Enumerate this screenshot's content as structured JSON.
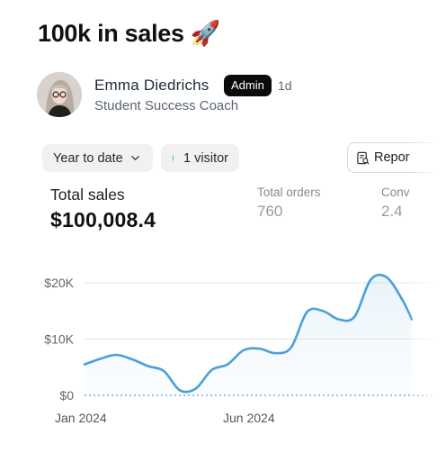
{
  "post": {
    "title": "100k in sales 🚀"
  },
  "author": {
    "name": "Emma Diedrichs",
    "badge": "Admin",
    "age": "1d",
    "role": "Student Success Coach"
  },
  "filters": {
    "range_label": "Year to date",
    "visitors_label": "1 visitor",
    "visitors_dot_color": "#39c56b"
  },
  "toolbar": {
    "report_label": "Repor"
  },
  "metrics": {
    "total_sales": {
      "label": "Total sales",
      "value": "$100,008.4"
    },
    "total_orders": {
      "label": "Total orders",
      "value": "760"
    },
    "conversion": {
      "label": "Conv",
      "value": "2.4"
    }
  },
  "chart_data": {
    "type": "area",
    "series_color": "#4a9fd8",
    "y_ticks": [
      "$20K",
      "$10K",
      "$0"
    ],
    "x_ticks": [
      "Jan 2024",
      "Jun 2024"
    ],
    "ylim": [
      0,
      22000
    ],
    "x": [
      0,
      0.5,
      1,
      1.5,
      2,
      2.5,
      3,
      3.5,
      4,
      4.5,
      5,
      5.5,
      6,
      6.5,
      7,
      7.5,
      8,
      8.5,
      9,
      9.5,
      10,
      10.3
    ],
    "values": [
      5500,
      6500,
      7200,
      6400,
      5200,
      4300,
      900,
      1200,
      4500,
      5500,
      8000,
      8300,
      7500,
      8500,
      14800,
      15000,
      13500,
      14000,
      20500,
      21000,
      17000,
      13500
    ]
  }
}
